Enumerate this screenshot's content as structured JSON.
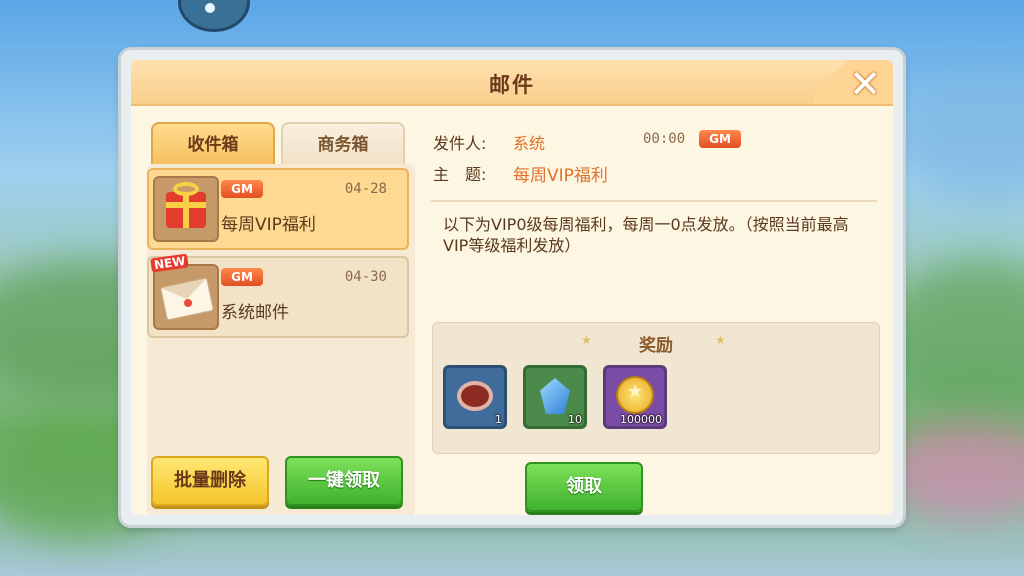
{
  "window": {
    "title": "邮件"
  },
  "tabs": [
    {
      "label": "收件箱",
      "active": true
    },
    {
      "label": "商务箱",
      "active": false
    }
  ],
  "mails": [
    {
      "badge": "GM",
      "date": "04-28",
      "subject": "每周VIP福利",
      "icon": "gift-icon",
      "active": true,
      "new_tag": ""
    },
    {
      "badge": "GM",
      "date": "04-30",
      "subject": "系统邮件",
      "icon": "envelope-icon",
      "active": false,
      "new_tag": "NEW"
    }
  ],
  "actions": {
    "batch_delete": "批量删除",
    "claim_all": "一键领取",
    "claim": "领取"
  },
  "detail": {
    "sender_label": "发件人:",
    "sender": "系统",
    "time": "00:00",
    "badge": "GM",
    "subject_label": "主　题:",
    "subject": "每周VIP福利",
    "body": "以下为VIP0级每周福利，每周一0点发放。（按照当前最高VIP等级福利发放）"
  },
  "rewards": {
    "title": "奖励",
    "items": [
      {
        "icon": "donut-icon",
        "count": "1",
        "frame": "blue"
      },
      {
        "icon": "gem-icon",
        "count": "10",
        "frame": "green"
      },
      {
        "icon": "coin-icon",
        "count": "100000",
        "frame": "purple"
      }
    ]
  },
  "colors": {
    "header": "#f9cf8c",
    "accent_orange": "#e0712a",
    "gm_badge": "#e24e22",
    "button_green": "#3fb22d",
    "button_yellow": "#f4c52c"
  }
}
